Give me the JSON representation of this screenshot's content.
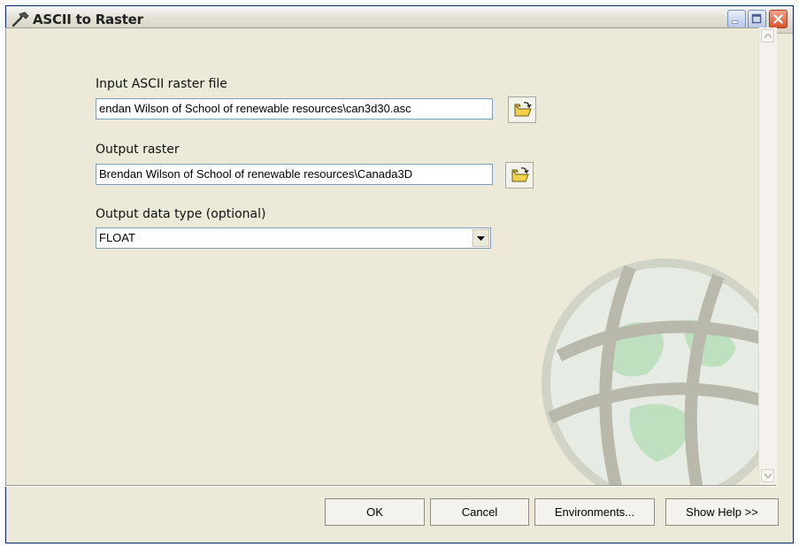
{
  "window": {
    "title": "ASCII to Raster",
    "controls": {
      "minimize": "minimize",
      "maximize": "maximize",
      "close": "close"
    }
  },
  "form": {
    "input_label": "Input ASCII raster file",
    "input_value": "endan Wilson of School of renewable resources\\can3d30.asc",
    "output_label": "Output raster",
    "output_value": "Brendan Wilson of School of renewable resources\\Canada3D",
    "datatype_label": "Output data type (optional)",
    "datatype_value": "FLOAT"
  },
  "buttons": {
    "ok": "OK",
    "cancel": "Cancel",
    "environments": "Environments...",
    "show_help": "Show Help >>"
  },
  "icons": {
    "title": "hammer-icon",
    "browse": "open-folder-icon",
    "dropdown": "chevron-down-icon",
    "watermark": "globe-icon"
  },
  "colors": {
    "dialog_bg": "#ece9d8",
    "close_button": "#d8522d",
    "input_border": "#7f9db9"
  }
}
